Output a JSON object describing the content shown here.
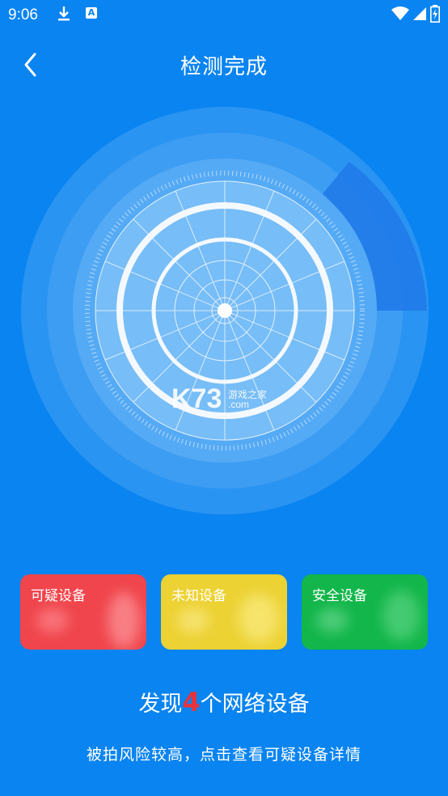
{
  "status_bar": {
    "time": "9:06"
  },
  "header": {
    "title": "检测完成"
  },
  "watermark": {
    "brand": "K73",
    "sub": "游戏之家",
    "domain": ".com"
  },
  "cards": {
    "suspicious": {
      "label": "可疑设备",
      "color": "#f0454c"
    },
    "unknown": {
      "label": "未知设备",
      "color": "#ecd233"
    },
    "safe": {
      "label": "安全设备",
      "color": "#12b64a"
    }
  },
  "summary": {
    "prefix": "发现",
    "count": "4",
    "suffix": "个网络设备",
    "count_color": "#e8323c"
  },
  "hint": "被拍风险较高，点击查看可疑设备详情",
  "colors": {
    "background": "#0a84f0"
  }
}
